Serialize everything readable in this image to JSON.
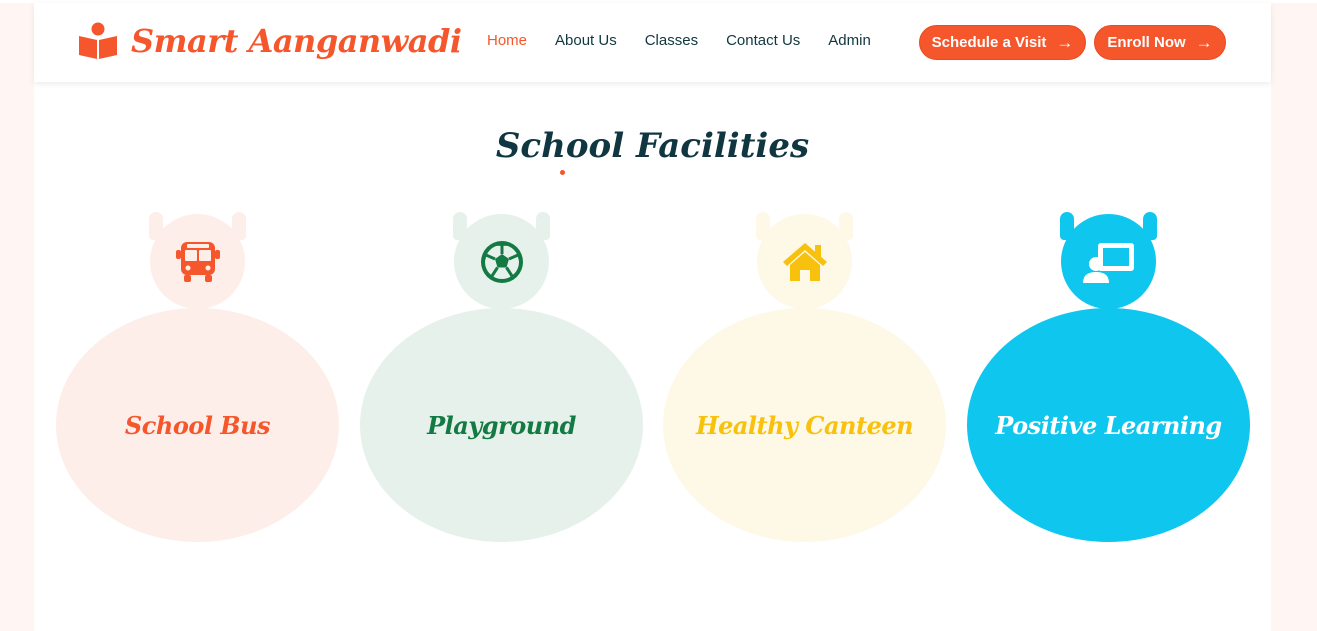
{
  "brand": {
    "name": "Smart Aanganwadi",
    "icon": "book-reader-icon"
  },
  "nav": [
    {
      "label": "Home",
      "active": true
    },
    {
      "label": "About Us",
      "active": false
    },
    {
      "label": "Classes",
      "active": false
    },
    {
      "label": "Contact Us",
      "active": false
    },
    {
      "label": "Admin",
      "active": false
    }
  ],
  "actions": {
    "schedule_label": "Schedule a Visit",
    "enroll_label": "Enroll Now",
    "arrow": "→"
  },
  "section": {
    "title": "School Facilities"
  },
  "facilities": [
    {
      "label": "School Bus",
      "icon": "bus-icon",
      "accent": "#f5562b",
      "bg": "#fdeeea"
    },
    {
      "label": "Playground",
      "icon": "football-icon",
      "accent": "#137a43",
      "bg": "#e7f1ec"
    },
    {
      "label": "Healthy Canteen",
      "icon": "home-icon",
      "accent": "#f7c10d",
      "bg": "#fef8e6"
    },
    {
      "label": "Positive Learning",
      "icon": "teacher-board-icon",
      "accent": "#ffffff",
      "bg": "#0ec6ee"
    }
  ],
  "colors": {
    "primary": "#f5562b",
    "dark": "#103741"
  }
}
